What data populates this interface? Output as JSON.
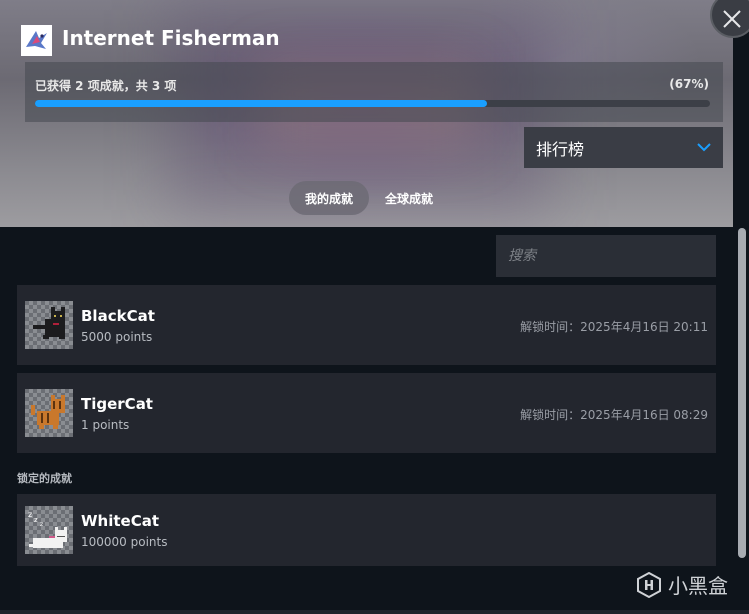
{
  "game": {
    "title": "Internet Fisherman"
  },
  "progress": {
    "summary": "已获得 2 项成就，共 3 项",
    "percent_label": "(67%)",
    "percent_value": 67
  },
  "dropdown": {
    "label": "排行榜"
  },
  "tabs": [
    {
      "label": "我的成就",
      "active": true
    },
    {
      "label": "全球成就",
      "active": false
    }
  ],
  "search": {
    "placeholder": "搜索"
  },
  "unlocked": [
    {
      "name": "BlackCat",
      "points": "5000 points",
      "time": "解锁时间：2025年4月16日 20:11"
    },
    {
      "name": "TigerCat",
      "points": "1 points",
      "time": "解锁时间：2025年4月16日 08:29"
    }
  ],
  "locked_section": {
    "label": "锁定的成就"
  },
  "locked": [
    {
      "name": "WhiteCat",
      "points": "100000 points"
    }
  ],
  "watermark": {
    "text": "小黑盒"
  },
  "colors": {
    "accent": "#1a9fff",
    "card": "#23262e",
    "background": "#0e141b"
  },
  "icons": [
    "close-icon",
    "game-logo",
    "chevron-down-icon",
    "black-cat-icon",
    "tiger-cat-icon",
    "white-cat-icon",
    "heybox-logo-icon"
  ]
}
